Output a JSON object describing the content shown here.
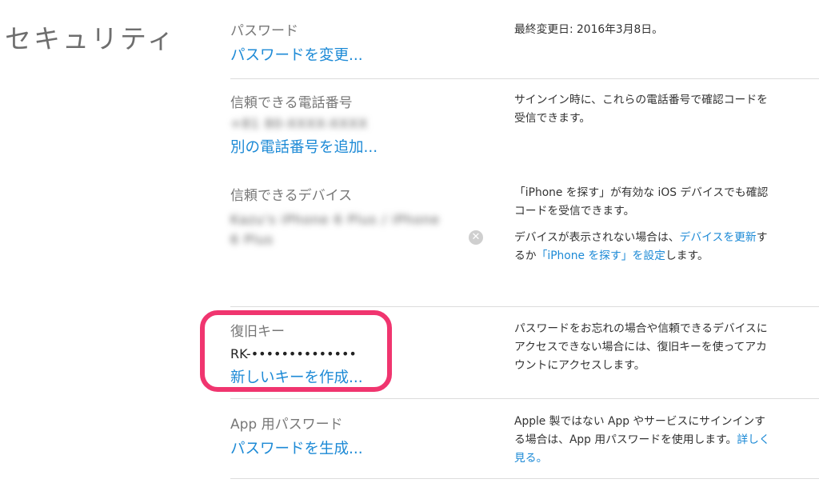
{
  "section": {
    "title": "セキュリティ"
  },
  "password": {
    "label": "パスワード",
    "change_link": "パスワードを変更...",
    "last_changed": "最終変更日: 2016年3月8日。"
  },
  "trusted_phone": {
    "label": "信頼できる電話番号",
    "numbers": [
      "+81 80-XXXX-XXXX"
    ],
    "add_link": "別の電話番号を追加...",
    "desc": "サインイン時に、これらの電話番号で確認コードを受信できます。"
  },
  "trusted_devices": {
    "label": "信頼できるデバイス",
    "devices_line1": "Kazu's iPhone 6 Plus / iPhone",
    "devices_line2": "6 Plus",
    "desc1": "「iPhone を探す」が有効な iOS デバイスでも確認コードを受信できます。",
    "desc2_prefix": "デバイスが表示されない場合は、",
    "update_link": "デバイスを更新",
    "desc2_mid": "するか",
    "find_link": "「iPhone を探す」を設定",
    "desc2_suffix": "します。"
  },
  "recovery_key": {
    "label": "復旧キー",
    "value": "RK-••••••••••••••",
    "create_link": "新しいキーを作成...",
    "desc": "パスワードをお忘れの場合や信頼できるデバイスにアクセスできない場合には、復旧キーを使ってアカウントにアクセスします。"
  },
  "app_password": {
    "label": "App 用パスワード",
    "generate_link": "パスワードを生成...",
    "desc_prefix": "Apple 製ではない App やサービスにサインインする場合は、App 用パスワードを使用します。",
    "learn_more_link": "詳しく見る。"
  },
  "colors": {
    "link": "#1d8ad6",
    "highlight": "#f0356f"
  }
}
